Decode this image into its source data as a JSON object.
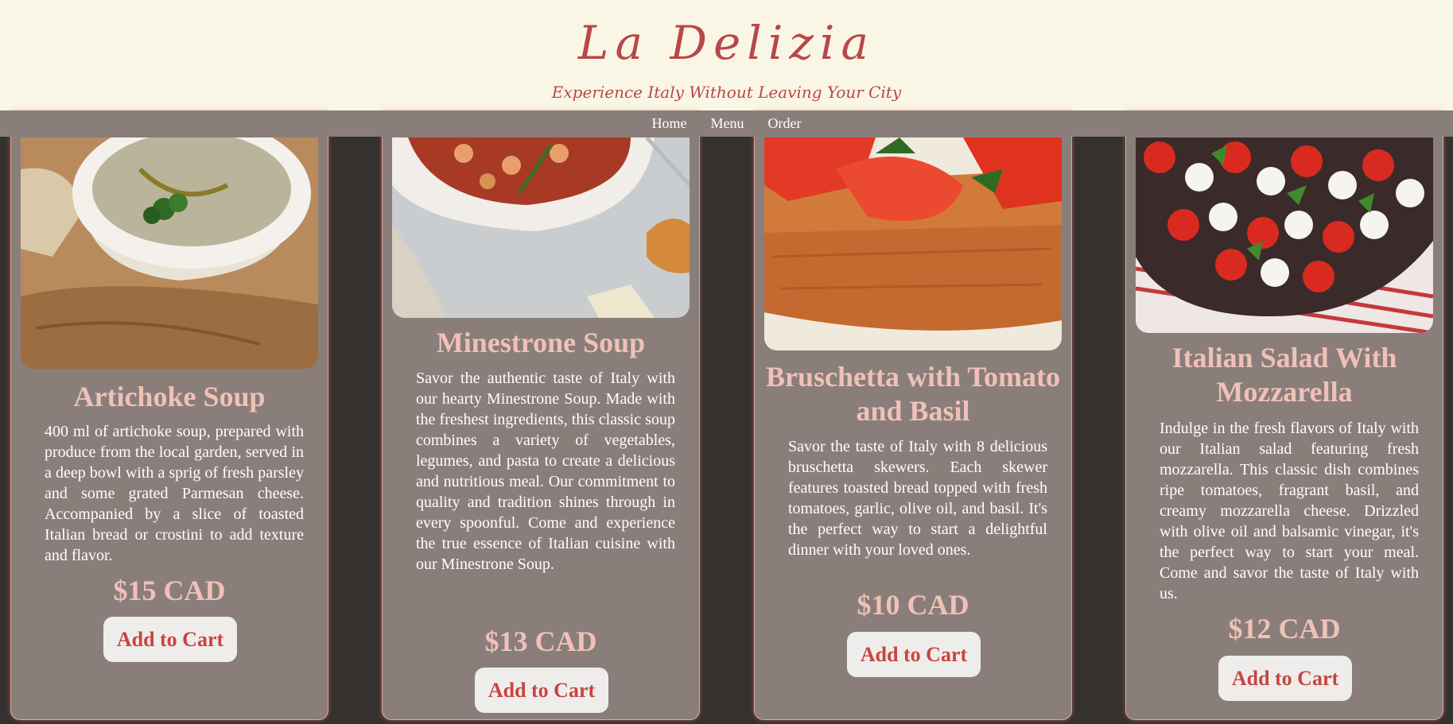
{
  "header": {
    "logo": "La Delizia",
    "tagline": "Experience Italy Without Leaving Your City"
  },
  "nav": {
    "items": [
      "Home",
      "Menu",
      "Order"
    ]
  },
  "products": [
    {
      "name": "Artichoke Soup",
      "description": "400 ml of artichoke soup, prepared with produce from the local garden, served in a deep bowl with a sprig of fresh parsley and some grated Parmesan cheese. Accompanied by a slice of toasted Italian bread or crostini to add texture and flavor.",
      "price": "$15 CAD",
      "button": "Add to Cart"
    },
    {
      "name": "Minestrone Soup",
      "description": "Savor the authentic taste of Italy with our hearty Minestrone Soup. Made with the freshest ingredients, this classic soup combines a variety of vegetables, legumes, and pasta to create a delicious and nutritious meal. Our commitment to quality and tradition shines through in every spoonful. Come and experience the true essence of Italian cuisine with our Minestrone Soup.",
      "price": "$13 CAD",
      "button": "Add to Cart"
    },
    {
      "name": "Bruschetta with Tomato and Basil",
      "description": "Savor the taste of Italy with 8 delicious bruschetta skewers. Each skewer features toasted bread topped with fresh tomatoes, garlic, olive oil, and basil. It's the perfect way to start a delightful dinner with your loved ones.",
      "price": "$10 CAD",
      "button": "Add to Cart"
    },
    {
      "name": "Italian Salad With Mozzarella",
      "description": "Indulge in the fresh flavors of Italy with our Italian salad featuring fresh mozzarella. This classic dish combines ripe tomatoes, fragrant basil, and creamy mozzarella cheese. Drizzled with olive oil and balsamic vinegar, it's the perfect way to start your meal. Come and savor the taste of Italy with us.",
      "price": "$12 CAD",
      "button": "Add to Cart"
    }
  ],
  "colors": {
    "header_bg": "#faf6e5",
    "nav_bg": "#8a7e7a",
    "page_bg": "#34312e",
    "card_bg": "#8a7e7a",
    "accent": "#b84848",
    "title_text": "#f0c1b8"
  }
}
